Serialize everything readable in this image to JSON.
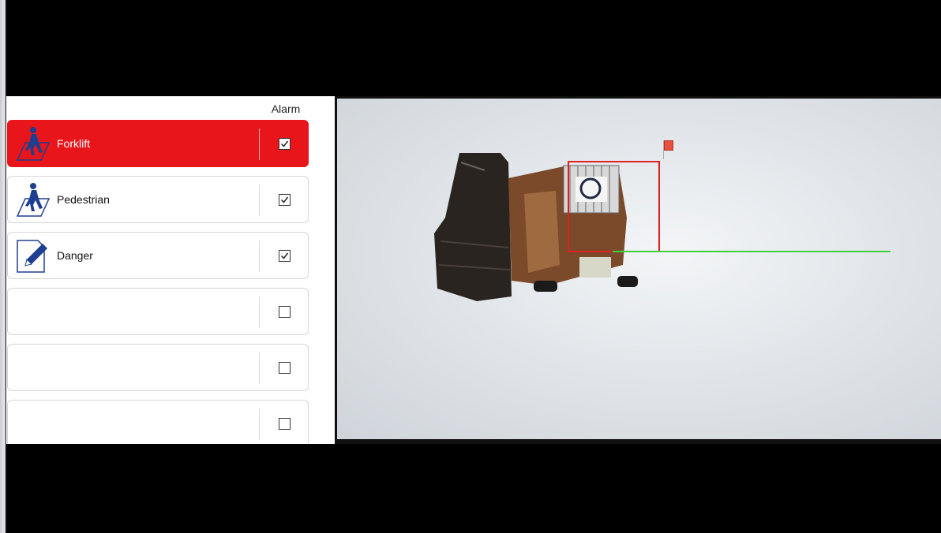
{
  "panel": {
    "alarm_header": "Alarm",
    "rows": [
      {
        "label": "Forklift",
        "icon": "pedestrian-zone-icon",
        "checked": true,
        "active": true
      },
      {
        "label": "Pedestrian",
        "icon": "pedestrian-zone-icon",
        "checked": true,
        "active": false
      },
      {
        "label": "Danger",
        "icon": "pencil-edit-icon",
        "checked": true,
        "active": false
      },
      {
        "label": "",
        "icon": "",
        "checked": false,
        "active": false
      },
      {
        "label": "",
        "icon": "",
        "checked": false,
        "active": false
      },
      {
        "label": "",
        "icon": "",
        "checked": false,
        "active": false
      }
    ]
  },
  "video": {
    "detection_box_color": "#e02020",
    "track_line_color": "#3ecf3e",
    "active_row_color": "#e8161b"
  }
}
